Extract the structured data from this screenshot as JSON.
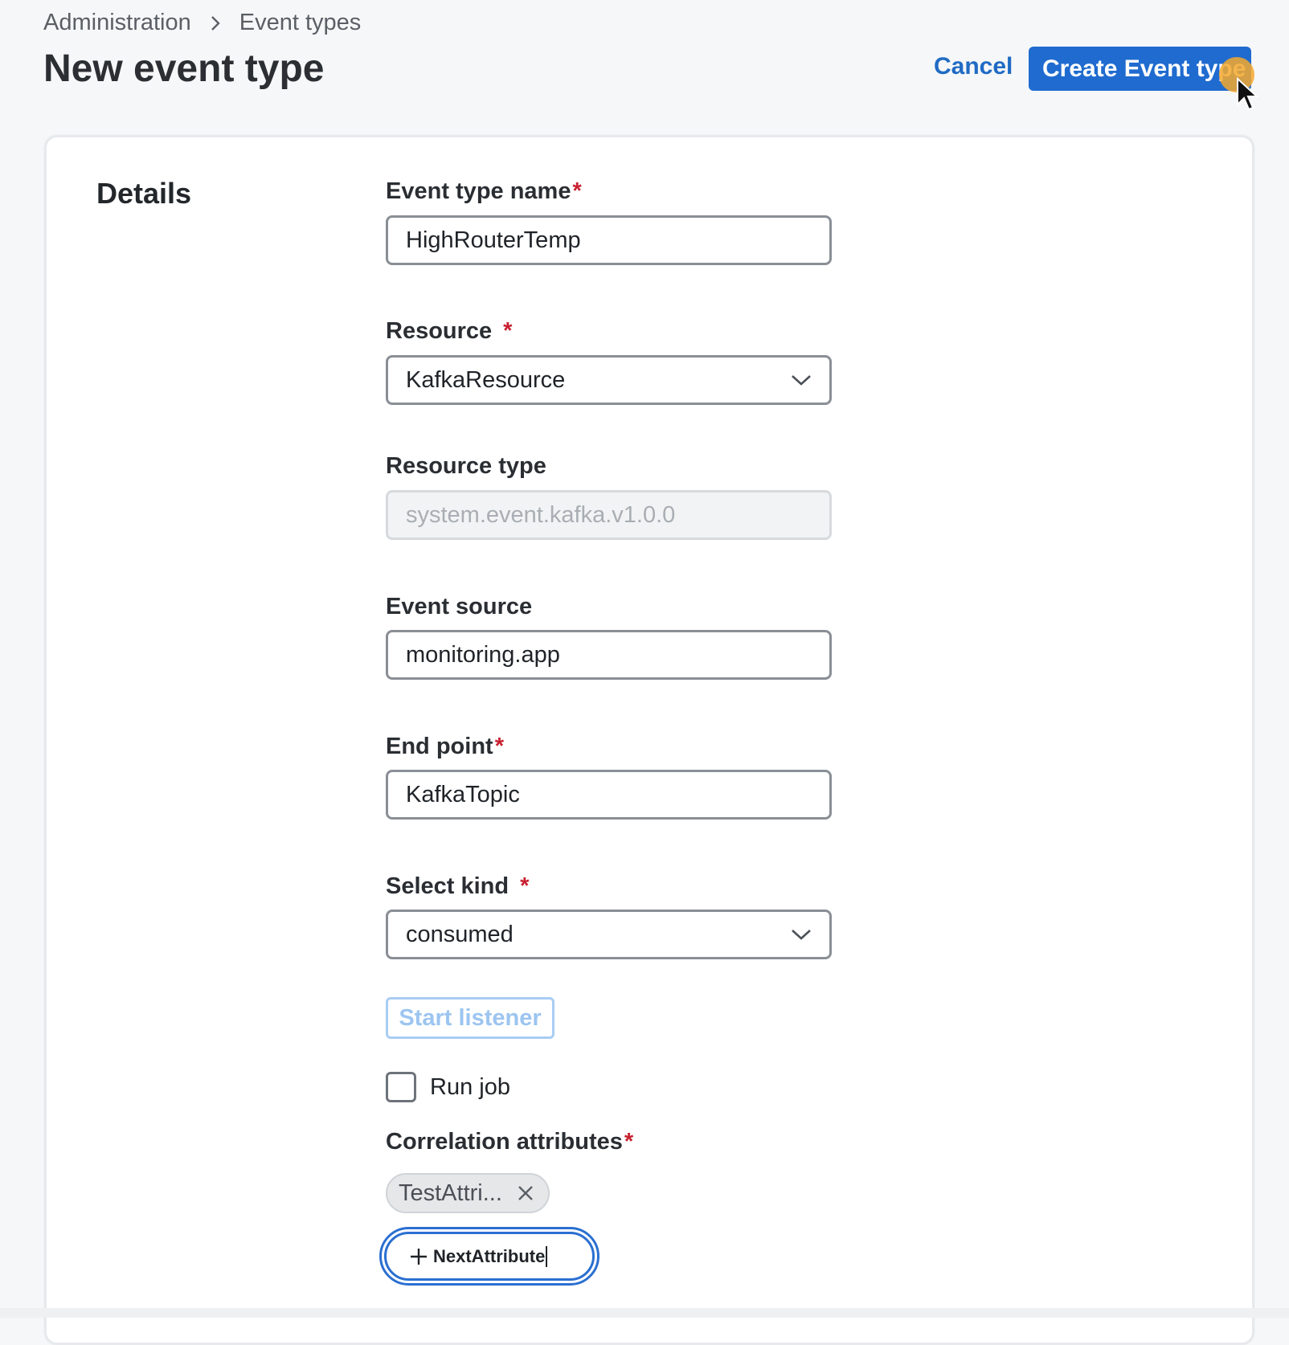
{
  "breadcrumb": {
    "items": [
      "Administration",
      "Event types"
    ]
  },
  "header": {
    "title": "New event type",
    "cancel_label": "Cancel",
    "create_label": "Create Event type"
  },
  "details": {
    "section_title": "Details",
    "event_type_name": {
      "label": "Event type name",
      "required": "*",
      "value": "HighRouterTemp"
    },
    "resource": {
      "label": "Resource",
      "required": "*",
      "value": "KafkaResource"
    },
    "resource_type": {
      "label": "Resource type",
      "value": "system.event.kafka.v1.0.0"
    },
    "event_source": {
      "label": "Event source",
      "value": "monitoring.app"
    },
    "end_point": {
      "label": "End point",
      "required": "*",
      "value": "KafkaTopic"
    },
    "select_kind": {
      "label": "Select kind",
      "required": "*",
      "value": "consumed"
    },
    "start_listener_label": "Start listener",
    "run_job_label": "Run job",
    "correlation": {
      "label": "Correlation attributes",
      "required": "*",
      "chips": [
        "TestAttri..."
      ],
      "new_attribute_value": "NextAttribute"
    }
  },
  "colors": {
    "primary": "#1f6bd0",
    "link": "#1f6bc4",
    "required": "#c8202f",
    "cursor_halo": "#f4a82d"
  },
  "icons": {
    "breadcrumb_separator": "chevron-right-icon",
    "select_arrow": "chevron-down-icon",
    "chip_remove": "close-icon",
    "add": "plus-icon",
    "pointer": "mouse-cursor-icon"
  }
}
